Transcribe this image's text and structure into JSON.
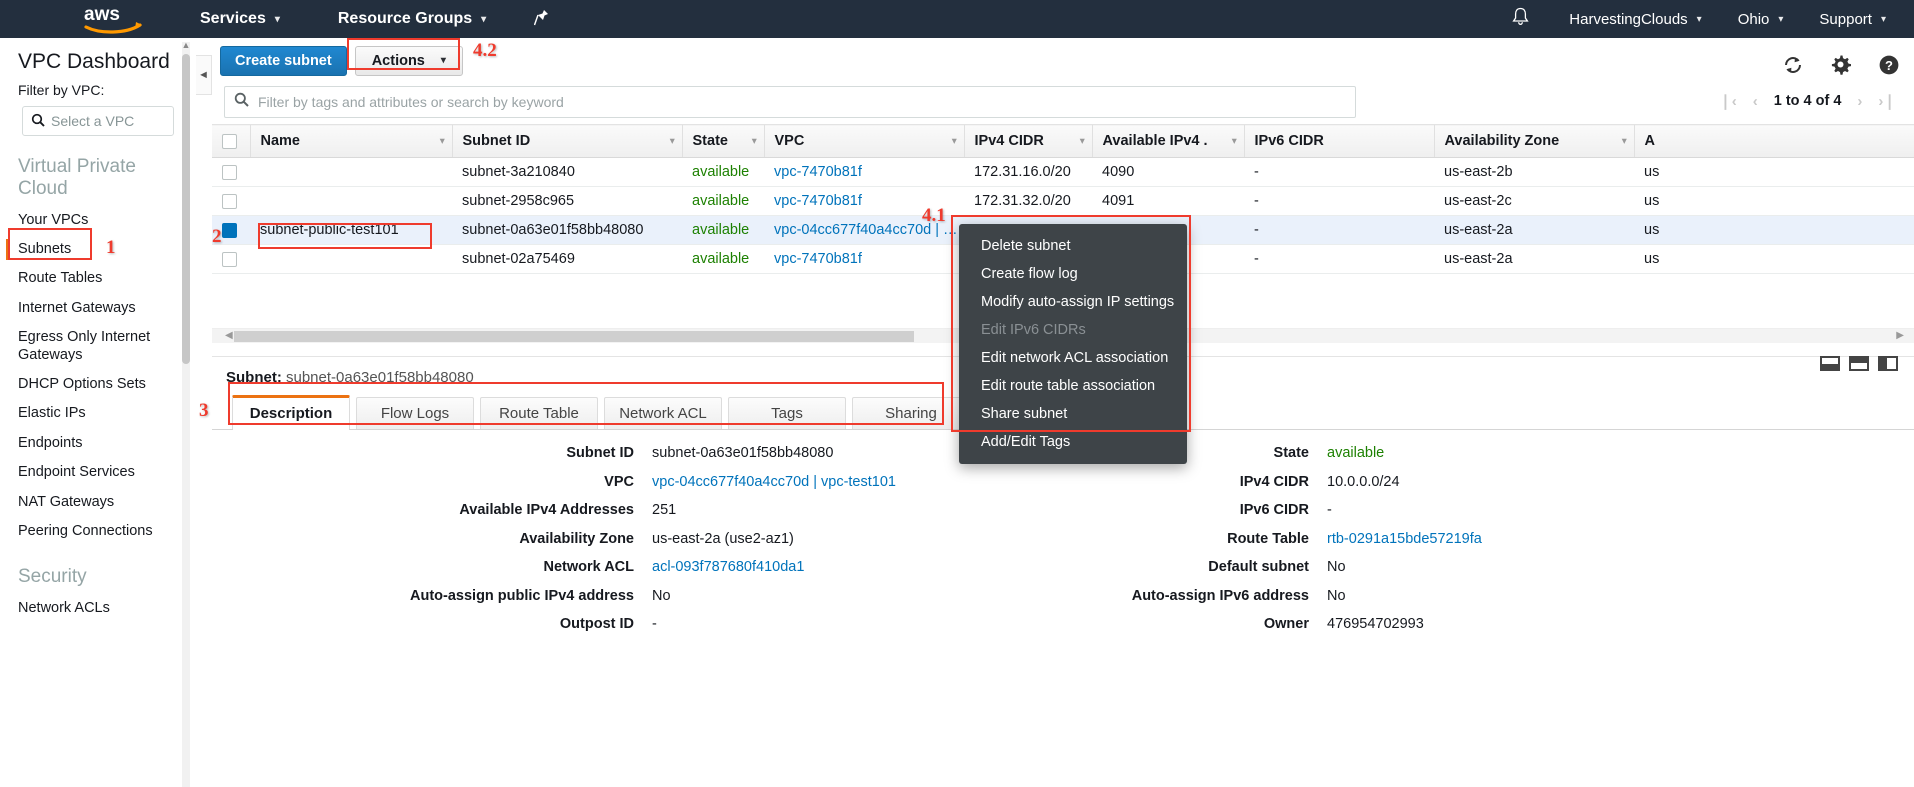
{
  "topnav": {
    "logo_alt": "aws",
    "services": "Services",
    "resource_groups": "Resource Groups",
    "pin_icon": "pin-icon",
    "bell_icon": "bell-icon",
    "account": "HarvestingClouds",
    "region": "Ohio",
    "support": "Support",
    "caret": "▾"
  },
  "sidebar": {
    "title": "VPC Dashboard",
    "filter_label": "Filter by VPC:",
    "vpc_select_placeholder": "Select a VPC",
    "sections": [
      {
        "label": "Virtual Private Cloud",
        "items": [
          "Your VPCs",
          "Subnets",
          "Route Tables",
          "Internet Gateways",
          "Egress Only Internet Gateways",
          "DHCP Options Sets",
          "Elastic IPs",
          "Endpoints",
          "Endpoint Services",
          "NAT Gateways",
          "Peering Connections"
        ]
      },
      {
        "label": "Security",
        "items": [
          "Network ACLs"
        ]
      }
    ],
    "active_item": "Subnets"
  },
  "toolbar": {
    "create_label": "Create subnet",
    "actions_label": "Actions",
    "actions_caret": "▾",
    "refresh_icon": "refresh-icon",
    "settings_icon": "gear-icon",
    "help_icon": "help-icon"
  },
  "search": {
    "placeholder": "Filter by tags and attributes or search by keyword",
    "icon": "search-icon"
  },
  "pager": {
    "first": "❘‹",
    "prev": "‹",
    "range": "1 to 4 of 4",
    "next": "›",
    "last": "›❘"
  },
  "table": {
    "columns": [
      "Name",
      "Subnet ID",
      "State",
      "VPC",
      "IPv4 CIDR",
      "Available IPv4 .",
      "IPv6 CIDR",
      "Availability Zone",
      "A"
    ],
    "sort_caret": "▾",
    "rows": [
      {
        "selected": false,
        "name": "",
        "subnet_id": "subnet-3a210840",
        "state": "available",
        "vpc": "vpc-7470b81f",
        "ipv4_cidr": "172.31.16.0/20",
        "available_ipv4": "4090",
        "ipv6_cidr": "-",
        "az": "us-east-2b",
        "az2": "us"
      },
      {
        "selected": false,
        "name": "",
        "subnet_id": "subnet-2958c965",
        "state": "available",
        "vpc": "vpc-7470b81f",
        "ipv4_cidr": "172.31.32.0/20",
        "available_ipv4": "4091",
        "ipv6_cidr": "-",
        "az": "us-east-2c",
        "az2": "us"
      },
      {
        "selected": true,
        "name": "subnet-public-test101",
        "subnet_id": "subnet-0a63e01f58bb48080",
        "state": "available",
        "vpc": "vpc-04cc677f40a4cc70d | …",
        "ipv4_cidr": "",
        "available_ipv4": "",
        "ipv6_cidr": "-",
        "az": "us-east-2a",
        "az2": "us"
      },
      {
        "selected": false,
        "name": "",
        "subnet_id": "subnet-02a75469",
        "state": "available",
        "vpc": "vpc-7470b81f",
        "ipv4_cidr": "",
        "available_ipv4": "",
        "ipv6_cidr": "-",
        "az": "us-east-2a",
        "az2": "us"
      }
    ]
  },
  "dropdown": {
    "items": [
      {
        "label": "Delete subnet",
        "disabled": false
      },
      {
        "label": "Create flow log",
        "disabled": false
      },
      {
        "label": "Modify auto-assign IP settings",
        "disabled": false
      },
      {
        "label": "Edit IPv6 CIDRs",
        "disabled": true
      },
      {
        "label": "Edit network ACL association",
        "disabled": false
      },
      {
        "label": "Edit route table association",
        "disabled": false
      },
      {
        "label": "Share subnet",
        "disabled": false
      },
      {
        "label": "Add/Edit Tags",
        "disabled": false
      }
    ]
  },
  "detail": {
    "header_label": "Subnet:",
    "header_value": "subnet-0a63e01f58bb48080",
    "tabs": [
      "Description",
      "Flow Logs",
      "Route Table",
      "Network ACL",
      "Tags",
      "Sharing"
    ],
    "active_tab": "Description",
    "panel_icons": [
      "panel-bottom-icon",
      "panel-split-icon",
      "panel-right-icon"
    ],
    "left_fields": [
      {
        "key": "Subnet ID",
        "value": "subnet-0a63e01f58bb48080",
        "style": "plain"
      },
      {
        "key": "VPC",
        "value": "vpc-04cc677f40a4cc70d | vpc-test101",
        "style": "link"
      },
      {
        "key": "Available IPv4 Addresses",
        "value": "251",
        "style": "plain"
      },
      {
        "key": "Availability Zone",
        "value": "us-east-2a (use2-az1)",
        "style": "plain"
      },
      {
        "key": "Network ACL",
        "value": "acl-093f787680f410da1",
        "style": "link"
      },
      {
        "key": "Auto-assign public IPv4 address",
        "value": "No",
        "style": "plain"
      },
      {
        "key": "Outpost ID",
        "value": "-",
        "style": "plain"
      }
    ],
    "right_fields": [
      {
        "key": "State",
        "value": "available",
        "style": "green"
      },
      {
        "key": "IPv4 CIDR",
        "value": "10.0.0.0/24",
        "style": "plain"
      },
      {
        "key": "IPv6 CIDR",
        "value": "-",
        "style": "plain"
      },
      {
        "key": "Route Table",
        "value": "rtb-0291a15bde57219fa",
        "style": "link"
      },
      {
        "key": "Default subnet",
        "value": "No",
        "style": "plain"
      },
      {
        "key": "Auto-assign IPv6 address",
        "value": "No",
        "style": "plain"
      },
      {
        "key": "Owner",
        "value": "476954702993",
        "style": "plain"
      }
    ]
  },
  "annotations": [
    {
      "id": "1",
      "label": "1"
    },
    {
      "id": "2",
      "label": "2"
    },
    {
      "id": "3",
      "label": "3"
    },
    {
      "id": "41",
      "label": "4.1"
    },
    {
      "id": "42",
      "label": "4.2"
    }
  ],
  "colors": {
    "nav_bg": "#232f3e",
    "accent_orange": "#ec7211",
    "link_blue": "#0073bb",
    "button_blue": "#1f89ce",
    "state_green": "#1d8102",
    "annotation_red": "#ef3b2d",
    "menu_bg": "#3e4448"
  }
}
